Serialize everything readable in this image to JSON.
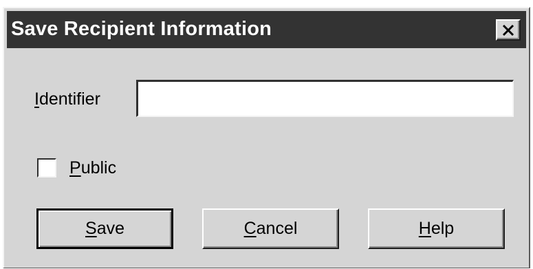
{
  "dialog": {
    "title": "Save Recipient Information",
    "close_icon": "close-icon",
    "colors": {
      "titlebar": "#333333",
      "face": "#d5d5d5",
      "title_text": "#ffffff"
    }
  },
  "identifier": {
    "mnemonic": "I",
    "label_rest": "dentifier",
    "value": "",
    "placeholder": ""
  },
  "public": {
    "mnemonic": "P",
    "label_rest": "ublic",
    "checked": false
  },
  "buttons": {
    "save": {
      "mnemonic": "S",
      "label_rest": "ave",
      "default": true
    },
    "cancel": {
      "mnemonic": "C",
      "label_rest": "ancel",
      "default": false
    },
    "help": {
      "mnemonic": "H",
      "label_rest": "elp",
      "default": false
    }
  }
}
